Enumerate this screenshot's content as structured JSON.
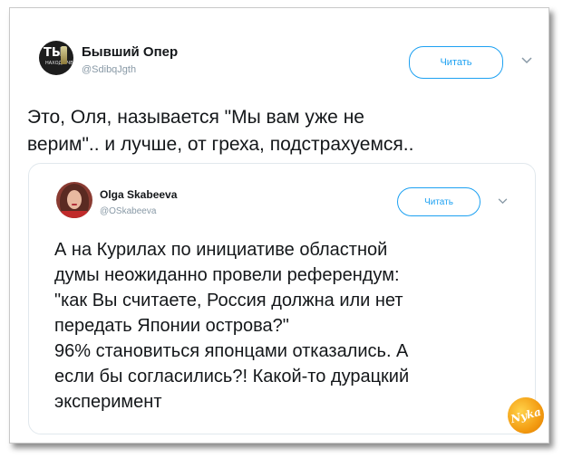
{
  "tweet": {
    "author_name": "Бывший Опер",
    "author_handle": "@SdibqJgth",
    "avatar_text_top": "ТЫ",
    "avatar_text_bottom": "НАХОДИ ЧЕ",
    "follow_label": "Читать",
    "text_lines": [
      "Это, Оля, называется \"Мы вам уже не",
      "верим\".. и лучше, от греха, подстрахуемся.."
    ]
  },
  "quoted_tweet": {
    "author_name": "Olga Skabeeva",
    "author_handle": "@OSkabeeva",
    "follow_label": "Читать",
    "text_lines": [
      "А на Курилах по инициативе областной",
      "думы неожиданно провели референдум:",
      "\"как Вы считаете, Россия должна или нет",
      "передать Японии острова?\"",
      "96% становиться японцами отказались. А",
      "если бы согласились?! Какой-то дурацкий",
      "эксперимент"
    ]
  },
  "watermark": {
    "text": "Nyka"
  },
  "colors": {
    "accent": "#1da1f2",
    "text": "#14171a",
    "muted": "#8899a6"
  }
}
